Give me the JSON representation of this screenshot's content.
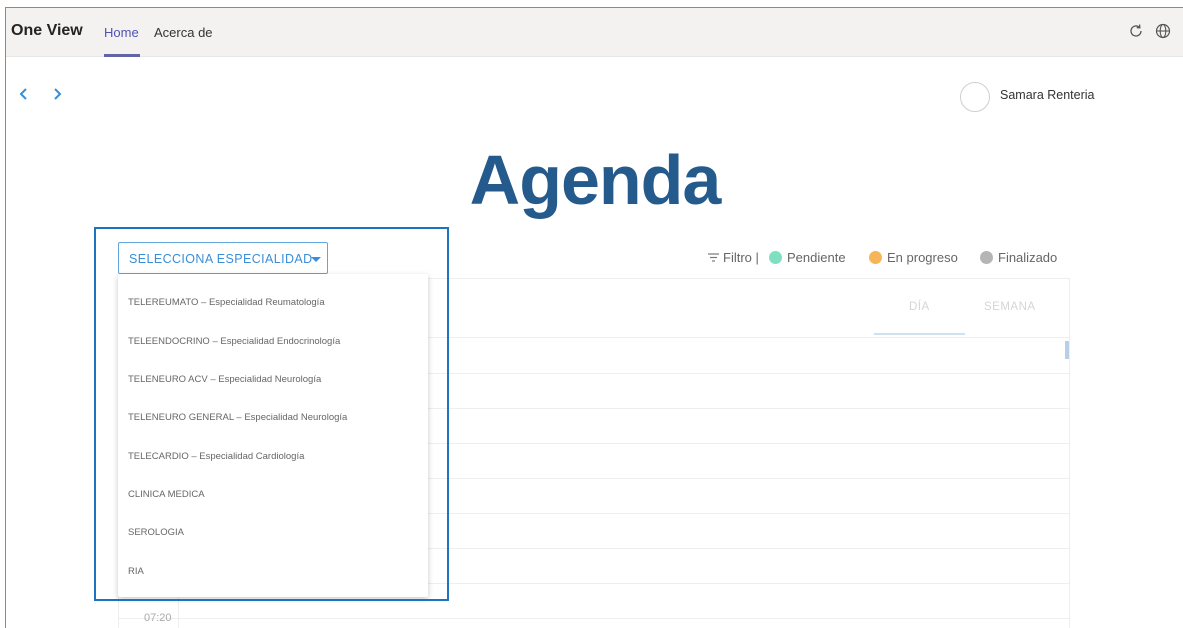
{
  "app": {
    "brand": "One View",
    "tabs": [
      {
        "label": "Home",
        "active": true
      },
      {
        "label": "Acerca de",
        "active": false
      }
    ],
    "icons": [
      "refresh-icon",
      "globe-icon"
    ]
  },
  "user": {
    "name": "Samara Renteria"
  },
  "page": {
    "title": "Agenda"
  },
  "selector": {
    "label": "SELECCIONA ESPECIALIDAD",
    "options": [
      "TELEREUMATO – Especialidad Reumatología",
      "TELEENDOCRINO – Especialidad Endocrinología",
      "TELENEURO ACV – Especialidad Neurología",
      "TELENEURO GENERAL – Especialidad Neurología",
      "TELECARDIO – Especialidad Cardiología",
      "CLINICA MEDICA",
      "SEROLOGIA",
      "RIA"
    ]
  },
  "legend": {
    "filter_label": "Filtro |",
    "items": [
      {
        "label": "Pendiente",
        "color": "#7ee0c0"
      },
      {
        "label": "En progreso",
        "color": "#f7b55a"
      },
      {
        "label": "Finalizado",
        "color": "#b5b5b5"
      }
    ]
  },
  "calendar": {
    "views": [
      "DÍA",
      "SEMANA"
    ],
    "time_label": "07:20"
  },
  "colors": {
    "accent": "#6264a7",
    "title": "#255a8c",
    "select": "#3a8ed8",
    "highlight": "#1e73be"
  }
}
